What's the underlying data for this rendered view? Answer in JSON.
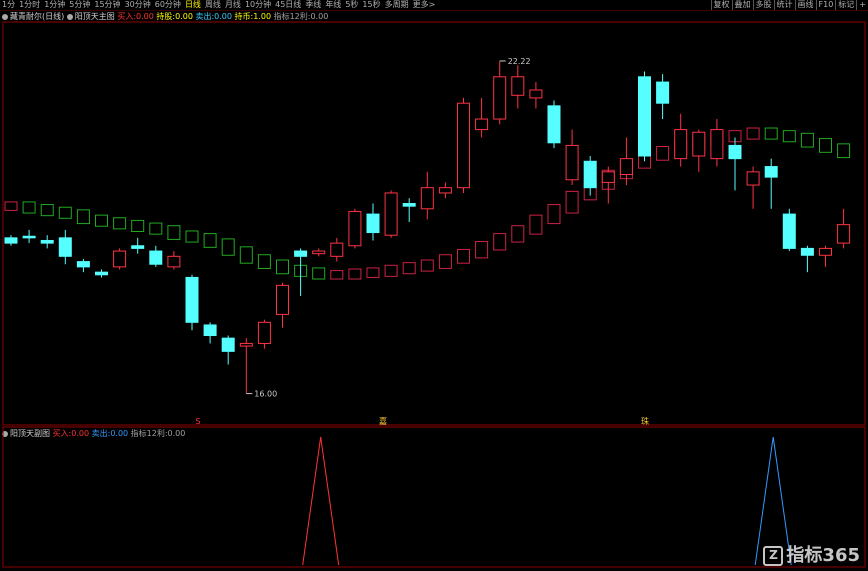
{
  "toolbar": {
    "periods": [
      "1分",
      "1分时",
      "1分钟",
      "5分钟",
      "15分钟",
      "30分钟",
      "60分钟",
      "日线",
      "周线",
      "月线",
      "10分钟",
      "45日线",
      "季线",
      "年线",
      "5秒",
      "15秒",
      "多周期",
      "更多>"
    ],
    "active_index": 7,
    "right_items": [
      "复权",
      "叠加",
      "多股",
      "统计",
      "画线",
      "F10",
      "标记",
      "+"
    ]
  },
  "main_legend": {
    "stock": "藏青耐尔(日线)",
    "indicator": "阳顶天主图",
    "buy_label": "买入:",
    "buy_value": "0.00",
    "hold_label": "持股:",
    "hold_value": "0.00",
    "sell_label": "卖出:",
    "sell_value": "0.00",
    "hold2_label": "持币:",
    "hold2_value": "1.00",
    "profit_label": "指标12利:",
    "profit_value": "0.00"
  },
  "sub_legend": {
    "indicator": "阳顶天副图",
    "buy_label": "买入:",
    "buy_value": "0.00",
    "sell_label": "卖出:",
    "sell_value": "0.00",
    "profit_label": "指标12利:",
    "profit_value": "0.00"
  },
  "price_labels": {
    "high": "22.22",
    "low": "16.00"
  },
  "markers": [
    "S",
    "嘉",
    "珠"
  ],
  "watermark": "指标365",
  "chart_data": {
    "type": "candlestick",
    "price_range": [
      15.5,
      23.0
    ],
    "candles": [
      {
        "o": 18.85,
        "c": 18.95,
        "h": 19.0,
        "l": 18.8,
        "up": false
      },
      {
        "o": 18.95,
        "c": 18.98,
        "h": 19.1,
        "l": 18.85,
        "up": false
      },
      {
        "o": 18.9,
        "c": 18.85,
        "h": 19.0,
        "l": 18.75,
        "up": false
      },
      {
        "o": 18.95,
        "c": 18.6,
        "h": 19.1,
        "l": 18.45,
        "up": false
      },
      {
        "o": 18.5,
        "c": 18.4,
        "h": 18.55,
        "l": 18.3,
        "up": false
      },
      {
        "o": 18.25,
        "c": 18.3,
        "h": 18.35,
        "l": 18.2,
        "up": false
      },
      {
        "o": 18.4,
        "c": 18.7,
        "h": 18.75,
        "l": 18.35,
        "up": true
      },
      {
        "o": 18.8,
        "c": 18.75,
        "h": 18.95,
        "l": 18.65,
        "up": false
      },
      {
        "o": 18.7,
        "c": 18.45,
        "h": 18.8,
        "l": 18.4,
        "up": false
      },
      {
        "o": 18.4,
        "c": 18.6,
        "h": 18.7,
        "l": 18.35,
        "up": true
      },
      {
        "o": 18.2,
        "c": 17.35,
        "h": 18.25,
        "l": 17.2,
        "up": false
      },
      {
        "o": 17.3,
        "c": 17.1,
        "h": 17.35,
        "l": 16.95,
        "up": false
      },
      {
        "o": 17.05,
        "c": 16.8,
        "h": 17.1,
        "l": 16.55,
        "up": false
      },
      {
        "o": 16.9,
        "c": 16.95,
        "h": 17.05,
        "l": 16.0,
        "up": true
      },
      {
        "o": 16.95,
        "c": 17.35,
        "h": 17.4,
        "l": 16.85,
        "up": true
      },
      {
        "o": 17.5,
        "c": 18.05,
        "h": 18.1,
        "l": 17.25,
        "up": true
      },
      {
        "o": 18.6,
        "c": 18.7,
        "h": 18.75,
        "l": 17.85,
        "up": false
      },
      {
        "o": 18.65,
        "c": 18.7,
        "h": 18.75,
        "l": 18.6,
        "up": true
      },
      {
        "o": 18.6,
        "c": 18.85,
        "h": 18.95,
        "l": 18.5,
        "up": true
      },
      {
        "o": 18.8,
        "c": 19.45,
        "h": 19.5,
        "l": 18.75,
        "up": true
      },
      {
        "o": 19.4,
        "c": 19.05,
        "h": 19.6,
        "l": 18.9,
        "up": false
      },
      {
        "o": 19.0,
        "c": 19.8,
        "h": 19.85,
        "l": 18.95,
        "up": true
      },
      {
        "o": 19.6,
        "c": 19.55,
        "h": 19.7,
        "l": 19.25,
        "up": false
      },
      {
        "o": 19.5,
        "c": 19.9,
        "h": 20.2,
        "l": 19.3,
        "up": true
      },
      {
        "o": 19.8,
        "c": 19.9,
        "h": 20.0,
        "l": 19.7,
        "up": true
      },
      {
        "o": 19.9,
        "c": 21.5,
        "h": 21.6,
        "l": 19.8,
        "up": true
      },
      {
        "o": 21.0,
        "c": 21.2,
        "h": 21.6,
        "l": 20.85,
        "up": true
      },
      {
        "o": 21.2,
        "c": 22.0,
        "h": 22.3,
        "l": 21.1,
        "up": true
      },
      {
        "o": 22.0,
        "c": 21.65,
        "h": 22.22,
        "l": 21.4,
        "up": true
      },
      {
        "o": 21.75,
        "c": 21.6,
        "h": 21.9,
        "l": 21.4,
        "up": true
      },
      {
        "o": 21.45,
        "c": 20.75,
        "h": 21.55,
        "l": 20.65,
        "up": false
      },
      {
        "o": 20.7,
        "c": 20.05,
        "h": 21.0,
        "l": 19.95,
        "up": true
      },
      {
        "o": 20.4,
        "c": 19.9,
        "h": 20.5,
        "l": 19.75,
        "up": false
      },
      {
        "o": 20.2,
        "c": 20.0,
        "h": 20.3,
        "l": 19.6,
        "up": true
      },
      {
        "o": 20.15,
        "c": 20.45,
        "h": 20.85,
        "l": 19.95,
        "up": true
      },
      {
        "o": 20.5,
        "c": 22.0,
        "h": 22.1,
        "l": 20.4,
        "up": false
      },
      {
        "o": 21.9,
        "c": 21.5,
        "h": 22.05,
        "l": 21.2,
        "up": false
      },
      {
        "o": 21.0,
        "c": 20.45,
        "h": 21.3,
        "l": 20.3,
        "up": true
      },
      {
        "o": 20.5,
        "c": 20.95,
        "h": 21.0,
        "l": 20.2,
        "up": true
      },
      {
        "o": 20.45,
        "c": 21.0,
        "h": 21.2,
        "l": 20.3,
        "up": true
      },
      {
        "o": 20.7,
        "c": 20.45,
        "h": 20.85,
        "l": 19.85,
        "up": false
      },
      {
        "o": 19.95,
        "c": 20.2,
        "h": 20.3,
        "l": 19.5,
        "up": true
      },
      {
        "o": 20.3,
        "c": 20.1,
        "h": 20.45,
        "l": 19.5,
        "up": false
      },
      {
        "o": 19.4,
        "c": 18.75,
        "h": 19.5,
        "l": 18.7,
        "up": false
      },
      {
        "o": 18.75,
        "c": 18.62,
        "h": 18.8,
        "l": 18.3,
        "up": false
      },
      {
        "o": 18.62,
        "c": 18.75,
        "h": 18.8,
        "l": 18.4,
        "up": true
      },
      {
        "o": 18.85,
        "c": 19.2,
        "h": 19.5,
        "l": 18.75,
        "up": true
      }
    ],
    "ma_line": [
      19.55,
      19.5,
      19.45,
      19.4,
      19.3,
      19.25,
      19.2,
      19.15,
      19.1,
      19.0,
      18.95,
      18.85,
      18.7,
      18.55,
      18.45,
      18.35,
      18.3,
      18.25,
      18.25,
      18.28,
      18.3,
      18.35,
      18.4,
      18.45,
      18.55,
      18.65,
      18.8,
      18.95,
      19.1,
      19.3,
      19.5,
      19.75,
      19.95,
      20.15,
      20.35,
      20.5,
      20.6,
      20.7,
      20.78,
      20.85,
      20.9,
      20.95,
      20.9,
      20.85,
      20.75,
      20.65,
      20.55
    ],
    "sub_signals": [
      {
        "index": 17,
        "color": "red"
      },
      {
        "index": 42,
        "color": "blue"
      }
    ]
  }
}
